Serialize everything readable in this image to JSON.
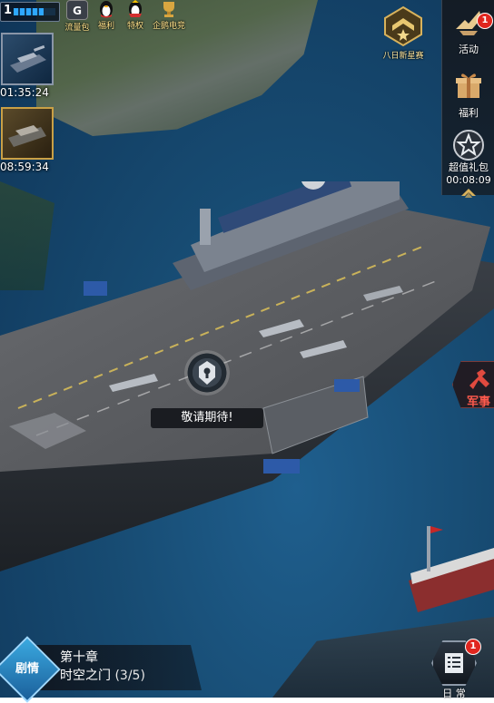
{
  "hud": {
    "level": "1",
    "energy_fraction": 0.72,
    "icons": [
      {
        "name": "traffic-pack-icon",
        "label": "流量包",
        "color": "#3a3f48"
      },
      {
        "name": "qq-welfare-icon",
        "label": "福利",
        "color": "#c62828"
      },
      {
        "name": "qq-privilege-icon",
        "label": "特权",
        "color": "#c62828"
      },
      {
        "name": "esports-icon",
        "label": "企鹅电竞",
        "color": "#b8862b"
      }
    ],
    "icon_letter": "G"
  },
  "timers": [
    {
      "time": "01:35:24",
      "style": "silver"
    },
    {
      "time": "08:59:34",
      "style": "gold"
    }
  ],
  "rank_emblem": {
    "label": "八日新星赛"
  },
  "right_rail": {
    "activity": {
      "label": "活动",
      "badge": "1"
    },
    "welfare": {
      "label": "福利"
    },
    "super_pack": {
      "label": "超值礼包",
      "countdown": "00:08:09"
    }
  },
  "military": {
    "label": "军事"
  },
  "coming_soon": {
    "label": "敬请期待!"
  },
  "story": {
    "label": "剧情",
    "chapter": "第十章",
    "mission": "时空之门",
    "progress": "(3/5)"
  },
  "daily": {
    "label": "日 常",
    "badge": "1"
  },
  "colors": {
    "sea": "#174b72",
    "accent_gold": "#d8b25c",
    "alert_red": "#e0261f",
    "story_blue": "#2a88c8"
  }
}
